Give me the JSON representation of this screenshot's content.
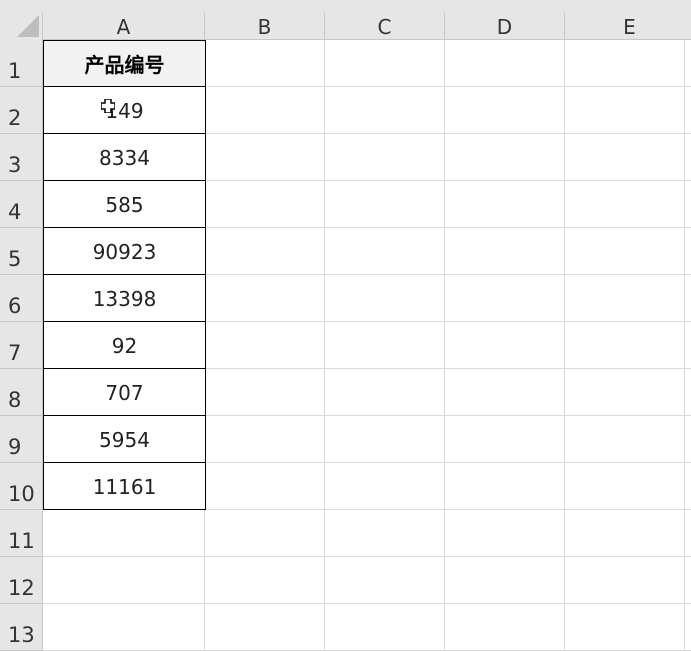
{
  "columns": [
    "A",
    "B",
    "C",
    "D",
    "E"
  ],
  "rows": [
    "1",
    "2",
    "3",
    "4",
    "5",
    "6",
    "7",
    "8",
    "9",
    "10",
    "11",
    "12",
    "13"
  ],
  "cells": {
    "header": "产品编号",
    "values": [
      "149",
      "8334",
      "585",
      "90923",
      "13398",
      "92",
      "707",
      "5954",
      "11161"
    ]
  }
}
